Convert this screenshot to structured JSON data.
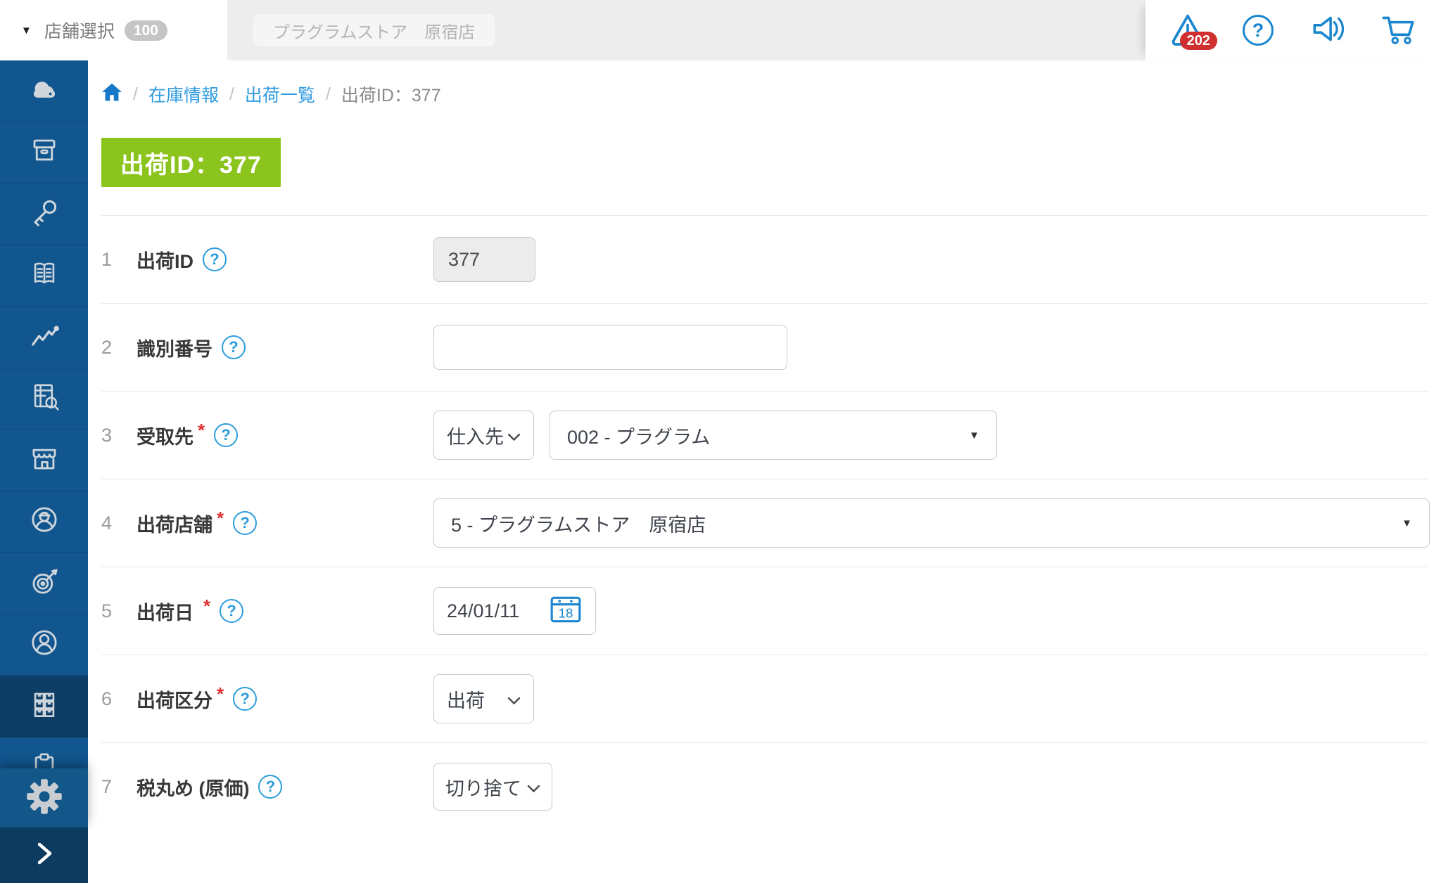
{
  "topbar": {
    "store_selector_label": "店舗選択",
    "store_selector_count": "100",
    "store_display": "プラグラムストア　原宿店",
    "alert_badge": "202",
    "help_glyph": "?"
  },
  "breadcrumb": {
    "sep": "/",
    "link1": "在庫情報",
    "link2": "出荷一覧",
    "current": "出荷ID：377"
  },
  "page_badge": "出荷ID：377",
  "glyphs": {
    "selector_caret": "▼",
    "dropdown_caret": "▼",
    "help": "?"
  },
  "sidebar_icons": [
    "cloud-storage",
    "archive-box",
    "key",
    "manual-book",
    "sales-trend",
    "inventory-sheet",
    "store",
    "staff",
    "target",
    "customer",
    "stock-drawers",
    "clipboard",
    "settings-gear",
    "expand-chevron"
  ],
  "sidebar_active_item": "stock-drawers",
  "form": {
    "rows": [
      {
        "num": "1",
        "label": "出荷ID",
        "required": "",
        "value": "377"
      },
      {
        "num": "2",
        "label": "識別番号",
        "required": "",
        "value": ""
      },
      {
        "num": "3",
        "label": "受取先",
        "required": "*",
        "type_value": "仕入先",
        "value": "002 - プラグラム"
      },
      {
        "num": "4",
        "label": "出荷店舗",
        "required": "*",
        "value": "5 - プラグラムストア　原宿店"
      },
      {
        "num": "5",
        "label": "出荷日",
        "required": "*",
        "value": "24/01/11",
        "calendar_day": "18"
      },
      {
        "num": "6",
        "label": "出荷区分",
        "required": "*",
        "value": "出荷"
      },
      {
        "num": "7",
        "label": "税丸め (原価)",
        "required": "",
        "value": "切り捨て"
      }
    ]
  },
  "colors": {
    "sidebar_blue": "#11568E",
    "sidebar_active": "#0E3E66",
    "accent_blue": "#1A86CF",
    "badge_green": "#8CC41E",
    "alert_red": "#D02F2F"
  }
}
